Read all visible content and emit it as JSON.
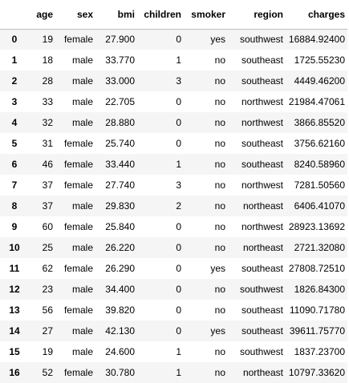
{
  "table": {
    "columns": [
      "",
      "age",
      "sex",
      "bmi",
      "children",
      "smoker",
      "region",
      "charges"
    ],
    "rows": [
      [
        "0",
        "19",
        "female",
        "27.900",
        "0",
        "yes",
        "southwest",
        "16884.92400"
      ],
      [
        "1",
        "18",
        "male",
        "33.770",
        "1",
        "no",
        "southeast",
        "1725.55230"
      ],
      [
        "2",
        "28",
        "male",
        "33.000",
        "3",
        "no",
        "southeast",
        "4449.46200"
      ],
      [
        "3",
        "33",
        "male",
        "22.705",
        "0",
        "no",
        "northwest",
        "21984.47061"
      ],
      [
        "4",
        "32",
        "male",
        "28.880",
        "0",
        "no",
        "northwest",
        "3866.85520"
      ],
      [
        "5",
        "31",
        "female",
        "25.740",
        "0",
        "no",
        "southeast",
        "3756.62160"
      ],
      [
        "6",
        "46",
        "female",
        "33.440",
        "1",
        "no",
        "southeast",
        "8240.58960"
      ],
      [
        "7",
        "37",
        "female",
        "27.740",
        "3",
        "no",
        "northwest",
        "7281.50560"
      ],
      [
        "8",
        "37",
        "male",
        "29.830",
        "2",
        "no",
        "northeast",
        "6406.41070"
      ],
      [
        "9",
        "60",
        "female",
        "25.840",
        "0",
        "no",
        "northwest",
        "28923.13692"
      ],
      [
        "10",
        "25",
        "male",
        "26.220",
        "0",
        "no",
        "northeast",
        "2721.32080"
      ],
      [
        "11",
        "62",
        "female",
        "26.290",
        "0",
        "yes",
        "southeast",
        "27808.72510"
      ],
      [
        "12",
        "23",
        "male",
        "34.400",
        "0",
        "no",
        "southwest",
        "1826.84300"
      ],
      [
        "13",
        "56",
        "female",
        "39.820",
        "0",
        "no",
        "southeast",
        "11090.71780"
      ],
      [
        "14",
        "27",
        "male",
        "42.130",
        "0",
        "yes",
        "southeast",
        "39611.75770"
      ],
      [
        "15",
        "19",
        "male",
        "24.600",
        "1",
        "no",
        "southwest",
        "1837.23700"
      ],
      [
        "16",
        "52",
        "female",
        "30.780",
        "1",
        "no",
        "northeast",
        "10797.33620"
      ]
    ]
  },
  "colors": {
    "stripe": "#f5f5f5",
    "header_rule": "#bdbdbd",
    "text": "#000000"
  }
}
